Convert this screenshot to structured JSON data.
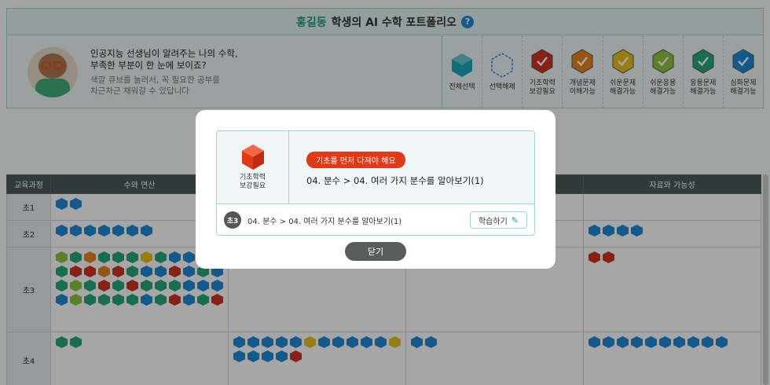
{
  "header": {
    "student_name": "홍길동",
    "title_rest": "학생의 AI 수학 포트폴리오",
    "help": "?",
    "intro_line1": "인공지능 선생님이 알려주는 나의 수학,",
    "intro_line2": "부족한 부분이 한 눈에 보이죠?",
    "intro_line3": "색깔 큐브를 눌러서, 꼭 필요한 공부를",
    "intro_line4": "차근차근 채워갈 수 있답니다"
  },
  "legend": [
    {
      "label": "전체선택",
      "color": "#1aa6b7",
      "style": "cube"
    },
    {
      "label": "선택해제",
      "color": "#1d8bd8",
      "style": "dashed"
    },
    {
      "label": "기초학력\n보강필요",
      "color": "#d2321e",
      "style": "check"
    },
    {
      "label": "개념문제\n이해가능",
      "color": "#e8831b",
      "style": "check"
    },
    {
      "label": "쉬운문제\n해결가능",
      "color": "#e6c21a",
      "style": "check"
    },
    {
      "label": "쉬운응용\n해결가능",
      "color": "#8cc63e",
      "style": "check"
    },
    {
      "label": "응용문제\n해결가능",
      "color": "#22a97a",
      "style": "check"
    },
    {
      "label": "심화문제\n해결가능",
      "color": "#1d8bd8",
      "style": "check"
    }
  ],
  "table": {
    "columns": [
      "교육과정",
      "수와 연산",
      "",
      "",
      "자료와 가능성"
    ],
    "rows": [
      {
        "grade": "초1",
        "cells": [
          [
            "b",
            "b"
          ],
          [],
          [],
          []
        ]
      },
      {
        "grade": "초2",
        "cells": [
          [
            "b",
            "b",
            "b",
            "b",
            "b",
            "b",
            "b"
          ],
          [],
          [],
          [
            "b",
            "b",
            "b",
            "b"
          ]
        ]
      },
      {
        "grade": "초3",
        "cells": [
          [
            "l",
            "g",
            "o",
            "g",
            "g",
            "g",
            "y",
            "g",
            "b",
            "b",
            "g",
            "r",
            "g",
            "r",
            "r",
            "o",
            "r",
            "g",
            "b",
            "b",
            "r",
            "b",
            "g",
            "b",
            "g",
            "l",
            "g",
            "r",
            "g",
            "r",
            "g",
            "g",
            "g",
            "b",
            "b",
            "b",
            "b",
            "l",
            "g",
            "g",
            "g",
            "g",
            "b",
            "g",
            "r",
            "b",
            "g",
            "r"
          ],
          [
            "g",
            "r",
            "r",
            "r",
            "r",
            "r",
            "r",
            "r",
            "r",
            "r"
          ],
          [],
          [
            "r",
            "r"
          ]
        ]
      },
      {
        "grade": "초4",
        "cells": [
          [
            "g",
            "g"
          ],
          [
            "b",
            "b",
            "b",
            "b",
            "b",
            "y",
            "b",
            "b",
            "b",
            "b",
            "b",
            "y",
            "b",
            "b",
            "b",
            "b",
            "r"
          ],
          [
            "b",
            "b"
          ],
          [
            "b",
            "b",
            "b",
            "b",
            "b",
            "b",
            "b",
            "b",
            "b",
            "b"
          ]
        ]
      }
    ]
  },
  "modal": {
    "icon_label": "기초학력\n보강필요",
    "badge": "기초를 먼저 다져야 해요",
    "path": "04. 분수 > 04. 여러 가지 분수를 알아보기(1)",
    "grade_badge": "초3",
    "sub_path": "04. 분수 > 04. 여러 가지 분수를 알아보기(1)",
    "study_label": "학습하기",
    "close_label": "닫기"
  },
  "cube_colors": {
    "b": "#1d8bd8",
    "g": "#22a97a",
    "r": "#d2321e",
    "o": "#e8831b",
    "y": "#e6c21a",
    "l": "#8cc63e"
  }
}
